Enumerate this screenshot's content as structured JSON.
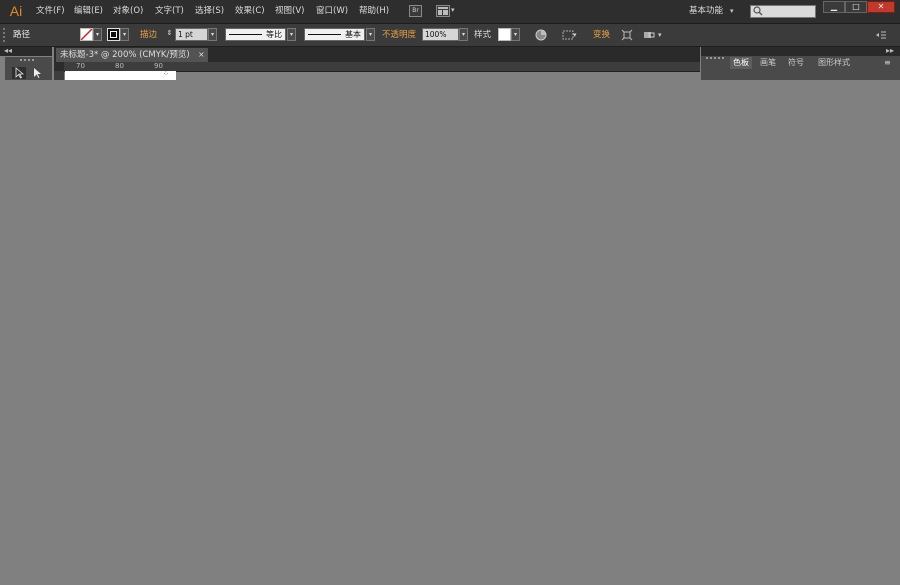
{
  "app": {
    "logo": "Ai"
  },
  "menu": [
    "文件(F)",
    "编辑(E)",
    "对象(O)",
    "文字(T)",
    "选择(S)",
    "效果(C)",
    "视图(V)",
    "窗口(W)",
    "帮助(H)"
  ],
  "menubar": {
    "bridge_label": "Br",
    "workspace_label": "基本功能",
    "caret": "▾",
    "window_buttons": [
      "▁",
      "□",
      "✕"
    ]
  },
  "control": {
    "mode_label": "路径",
    "stroke_label": "描边",
    "stroke_weight": "1 pt",
    "profile_label": "等比",
    "brush_label": "基本",
    "opacity_label": "不透明度",
    "opacity_value": "100%",
    "style_label": "样式",
    "transform_label": "变换"
  },
  "document": {
    "tab_title": "未标题-3* @ 200% (CMYK/预览)",
    "close": "×",
    "ruler_ticks": [
      "70",
      "80",
      "90"
    ]
  },
  "panels": {
    "collapse_left": "◂◂",
    "collapse_right": "▸▸",
    "right_tabs": [
      "色板",
      "画笔",
      "符号",
      "图形样式"
    ],
    "right_menu": "≡"
  },
  "colors": {
    "accent": "#e8a048",
    "canvas": "#808080",
    "chrome": "#2e2e2e",
    "control_bar": "#3b3b3b"
  },
  "icons": {
    "selection_tool": "selection-arrow-icon",
    "direct_selection_tool": "direct-selection-arrow-icon",
    "search": "search-icon",
    "recolor": "recolor-artwork-icon",
    "align": "align-icon",
    "arrange_docs": "arrange-documents-icon"
  }
}
